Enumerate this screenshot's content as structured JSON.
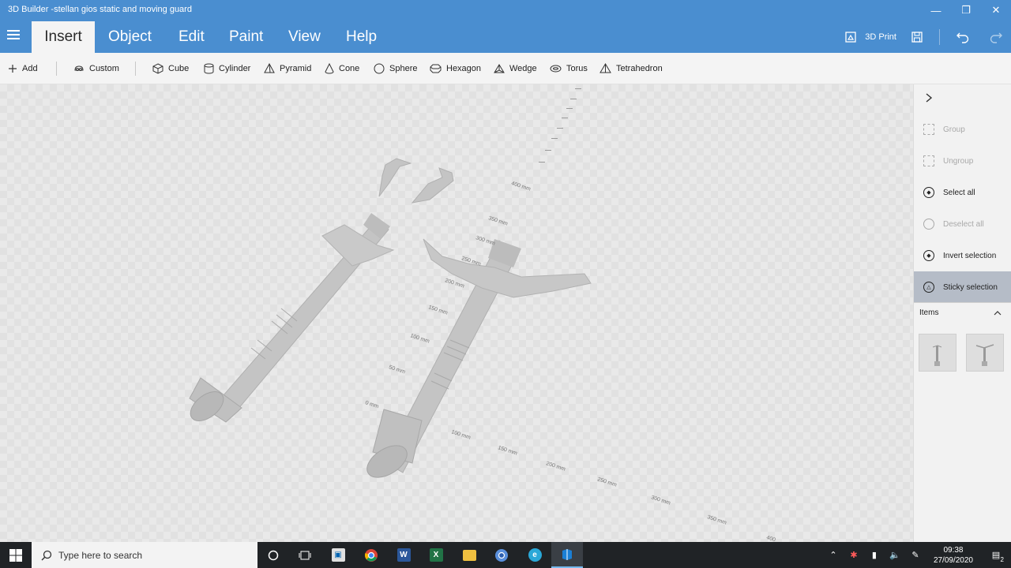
{
  "window": {
    "title": "3D Builder -stellan gios static and moving guard"
  },
  "menu": {
    "tabs": [
      {
        "label": "Insert",
        "active": true
      },
      {
        "label": "Object"
      },
      {
        "label": "Edit"
      },
      {
        "label": "Paint"
      },
      {
        "label": "View"
      },
      {
        "label": "Help"
      }
    ],
    "print_label": "3D Print"
  },
  "toolbar": {
    "add": "Add",
    "custom": "Custom",
    "shapes": [
      "Cube",
      "Cylinder",
      "Pyramid",
      "Cone",
      "Sphere",
      "Hexagon",
      "Wedge",
      "Torus",
      "Tetrahedron"
    ]
  },
  "ruler": {
    "vertical": [
      "0 mm",
      "50 mm",
      "100 mm",
      "150 mm",
      "200 mm",
      "250 mm",
      "300 mm",
      "350 mm",
      "400 mm"
    ],
    "horizontal": [
      "100 mm",
      "150 mm",
      "200 mm",
      "250 mm",
      "300 mm",
      "350 mm",
      "400"
    ]
  },
  "panel": {
    "actions": [
      {
        "label": "Group",
        "state": "disabled",
        "icon": "group-icon"
      },
      {
        "label": "Ungroup",
        "state": "disabled",
        "icon": "ungroup-icon"
      },
      {
        "label": "Select all",
        "state": "enabled",
        "icon": "select-all-icon"
      },
      {
        "label": "Deselect all",
        "state": "disabled",
        "icon": "deselect-all-icon"
      },
      {
        "label": "Invert selection",
        "state": "enabled",
        "icon": "invert-selection-icon"
      },
      {
        "label": "Sticky selection",
        "state": "active",
        "icon": "sticky-selection-icon"
      }
    ],
    "items_label": "Items",
    "items_count": 2
  },
  "taskbar": {
    "search_placeholder": "Type here to search",
    "time": "09:38",
    "date": "27/09/2020",
    "notifications": "2"
  },
  "colors": {
    "titlebar": "#4a8ed0",
    "toolbar": "#f4f4f4",
    "taskbar": "#202326",
    "model": "#c2c2c2"
  }
}
